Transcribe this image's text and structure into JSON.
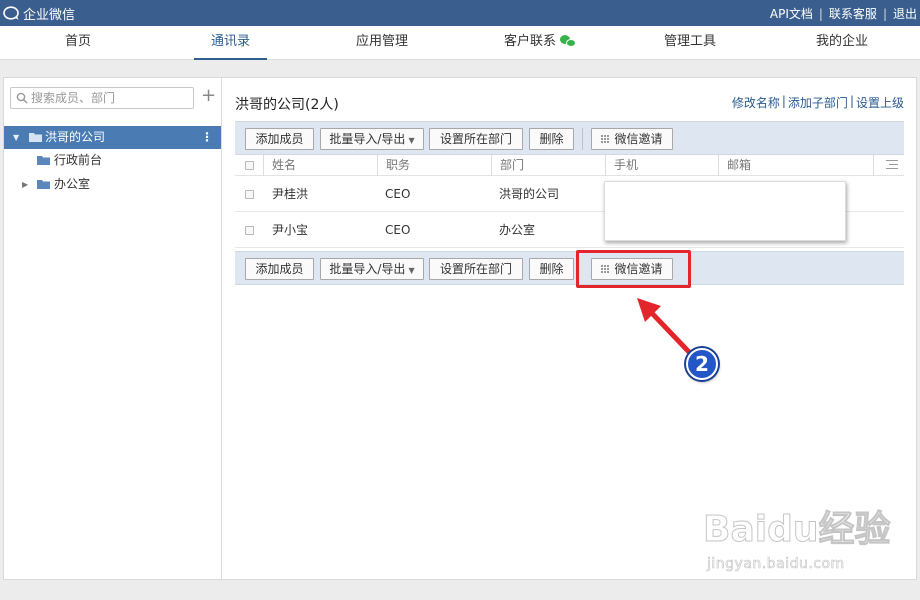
{
  "app": {
    "title": "企业微信",
    "top_links": [
      "API文档",
      "联系客服",
      "退出"
    ]
  },
  "nav": {
    "tabs": [
      {
        "label": "首页",
        "active": false
      },
      {
        "label": "通讯录",
        "active": true
      },
      {
        "label": "应用管理",
        "active": false
      },
      {
        "label": "客户联系",
        "active": false,
        "icon": "wechat-icon"
      },
      {
        "label": "管理工具",
        "active": false
      },
      {
        "label": "我的企业",
        "active": false
      }
    ]
  },
  "sidebar": {
    "search_placeholder": "搜索成员、部门",
    "add_label": "+",
    "tree": [
      {
        "label": "洪哥的公司",
        "selected": true,
        "expanded": true
      },
      {
        "label": "行政前台",
        "selected": false
      },
      {
        "label": "办公室",
        "selected": false,
        "expandable": true
      }
    ]
  },
  "main": {
    "title": "洪哥的公司(2人)",
    "dept_links": [
      "修改名称",
      "添加子部门",
      "设置上级"
    ],
    "toolbar": {
      "add_member": "添加成员",
      "batch": "批量导入/导出",
      "set_dept": "设置所在部门",
      "delete": "删除",
      "wechat_invite": "微信邀请"
    },
    "table": {
      "columns": [
        "姓名",
        "职务",
        "部门",
        "手机",
        "邮箱"
      ],
      "rows": [
        {
          "name": "尹桂洪",
          "title": "CEO",
          "dept": "洪哥的公司",
          "phone": "",
          "email": ""
        },
        {
          "name": "尹小宝",
          "title": "CEO",
          "dept": "办公室",
          "phone": "",
          "email": ""
        }
      ]
    }
  },
  "annotation": {
    "step": "2",
    "highlight_color": "#e3262b",
    "badge_color": "#2556c8"
  },
  "watermark": {
    "logo": "Baidu经验",
    "url": "jingyan.baidu.com"
  },
  "colors": {
    "topbar": "#3a5f8f",
    "selected_row": "#4a7cb3",
    "toolbar_bg": "#dde6f1",
    "link": "#2a5b8f"
  }
}
